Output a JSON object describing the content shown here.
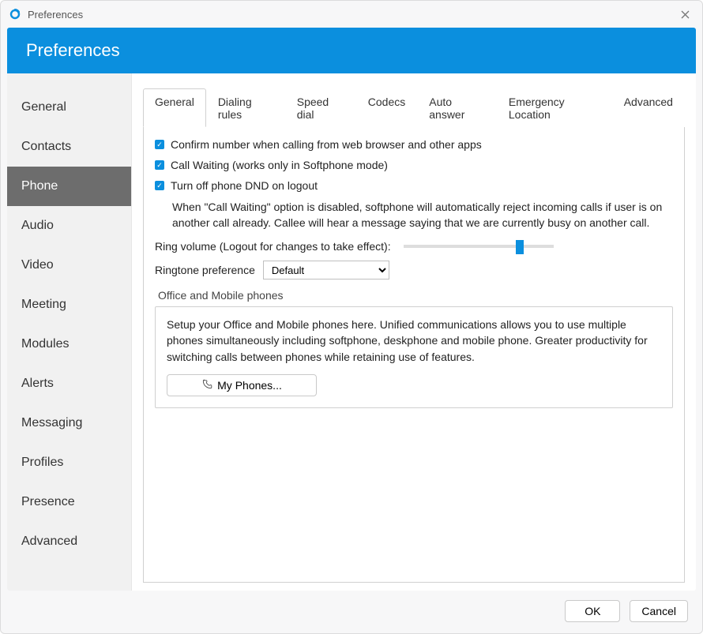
{
  "window": {
    "title": "Preferences"
  },
  "banner": {
    "title": "Preferences"
  },
  "sidebar": {
    "items": [
      {
        "label": "General"
      },
      {
        "label": "Contacts"
      },
      {
        "label": "Phone",
        "active": true
      },
      {
        "label": "Audio"
      },
      {
        "label": "Video"
      },
      {
        "label": "Meeting"
      },
      {
        "label": "Modules"
      },
      {
        "label": "Alerts"
      },
      {
        "label": "Messaging"
      },
      {
        "label": "Profiles"
      },
      {
        "label": "Presence"
      },
      {
        "label": "Advanced"
      }
    ]
  },
  "tabs": [
    {
      "label": "General",
      "active": true
    },
    {
      "label": "Dialing rules"
    },
    {
      "label": "Speed dial"
    },
    {
      "label": "Codecs"
    },
    {
      "label": "Auto answer"
    },
    {
      "label": "Emergency Location"
    },
    {
      "label": "Advanced"
    }
  ],
  "general": {
    "checks": [
      {
        "label": "Confirm number when calling from web browser and other apps",
        "checked": true
      },
      {
        "label": "Call Waiting (works only in Softphone mode)",
        "checked": true
      },
      {
        "label": "Turn off phone DND on logout",
        "checked": true
      }
    ],
    "call_waiting_note": "When \"Call Waiting\" option is disabled, softphone will automatically reject incoming calls if user is on another call already. Callee will hear a message saying that we are currently busy on another call.",
    "ring_volume_label": "Ring volume (Logout for changes to take effect):",
    "ring_volume_percent": 75,
    "ringtone_label": "Ringtone preference",
    "ringtone_value": "Default",
    "ringtone_options": [
      "Default"
    ],
    "office_section_title": "Office and Mobile phones",
    "office_description": "Setup your Office and Mobile phones here. Unified communications allows you to use multiple phones simultaneously including softphone, deskphone and mobile phone. Greater productivity for switching calls between phones while retaining use of features.",
    "my_phones_label": "My Phones..."
  },
  "footer": {
    "ok": "OK",
    "cancel": "Cancel"
  }
}
